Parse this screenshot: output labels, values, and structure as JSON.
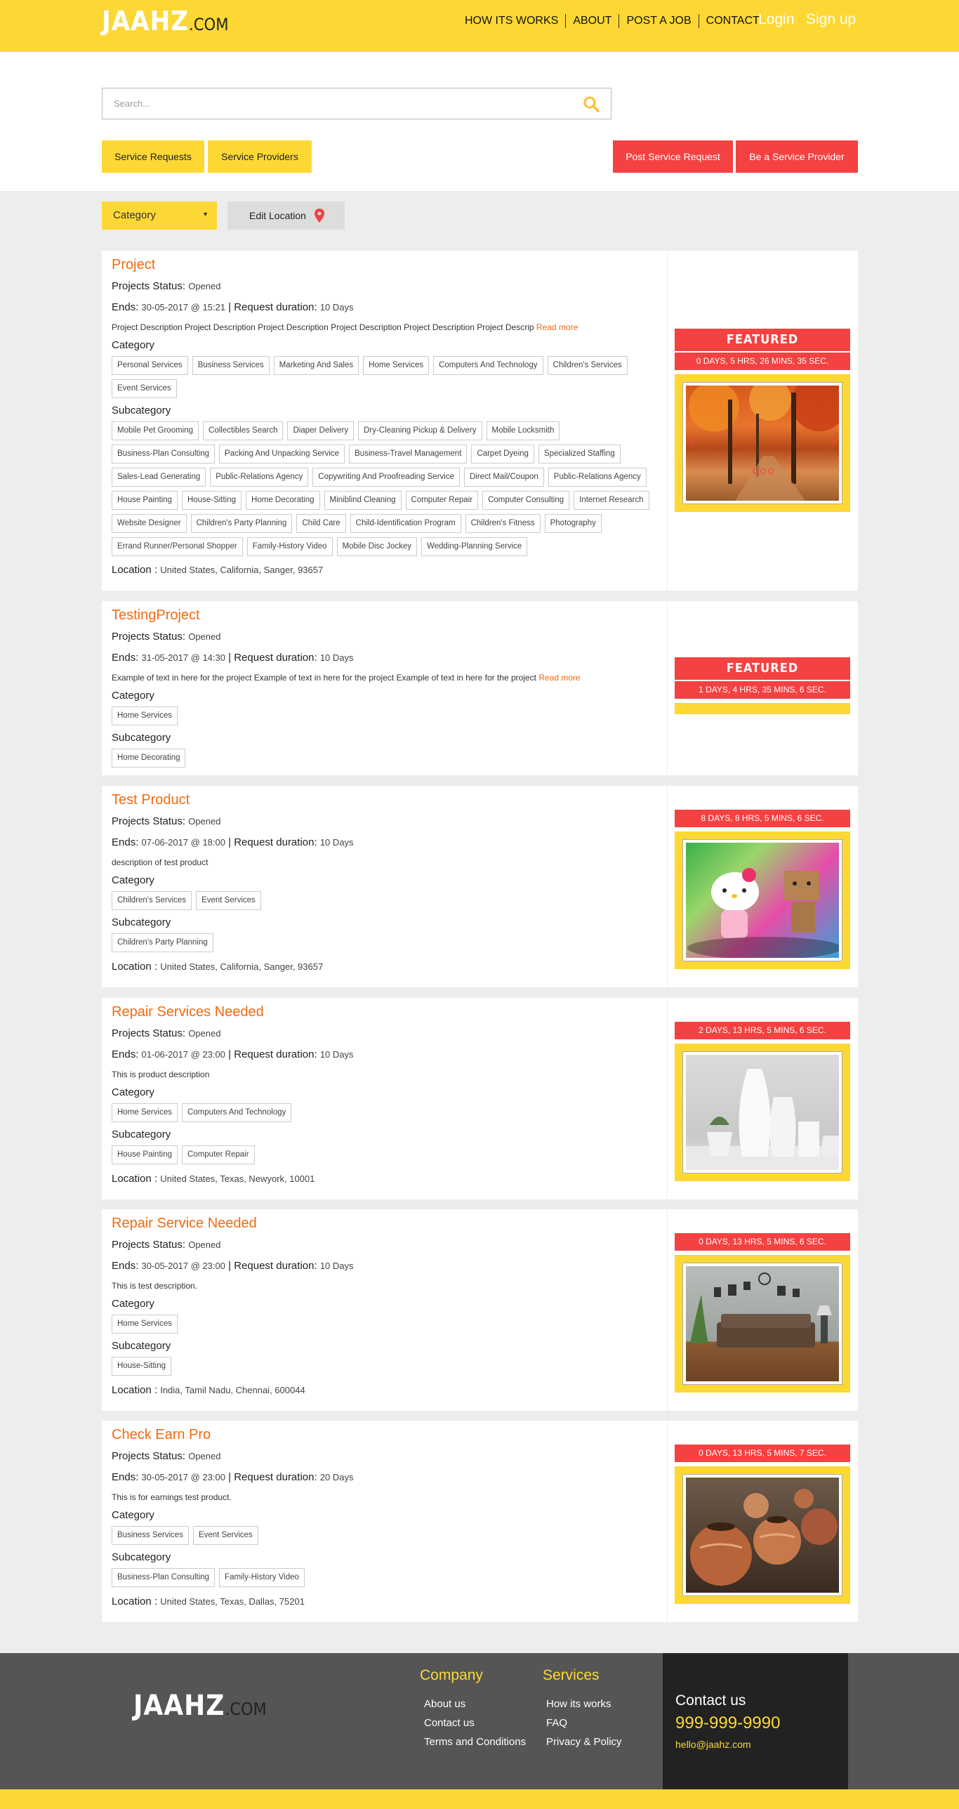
{
  "header": {
    "logo_main": "JAAHZ",
    "logo_suffix": ".COM",
    "nav": [
      "HOW ITS WORKS",
      "ABOUT",
      "POST A JOB",
      "CONTACT"
    ],
    "login": "Login",
    "signup": "Sign up"
  },
  "search": {
    "placeholder": "Search..."
  },
  "buttons": {
    "service_requests": "Service Requests",
    "service_providers": "Service Providers",
    "post_request": "Post Service Request",
    "be_provider": "Be a Service Provider"
  },
  "filters": {
    "category": "Category",
    "edit_location": "Edit Location"
  },
  "labels": {
    "status": "Projects Status:",
    "ends": "Ends:",
    "duration": "Request duration:",
    "category": "Category",
    "subcategory": "Subcategory",
    "location": "Location :",
    "read_more": "Read more",
    "featured": "FEATURED"
  },
  "projects": [
    {
      "title": "Project",
      "status": "Opened",
      "ends": "30-05-2017 @ 15:21",
      "duration": "10 Days",
      "desc": "Project Description Project Description Project Description Project Description Project Description Project Descrip",
      "categories": [
        "Personal Services",
        "Business Services",
        "Marketing And Sales",
        "Home Services",
        "Computers And Technology",
        "Children's Services",
        "Event Services"
      ],
      "subcategories": [
        "Mobile Pet Grooming",
        "Collectibles Search",
        "Diaper Delivery",
        "Dry-Cleaning Pickup & Delivery",
        "Mobile Locksmith",
        "Business-Plan Consulting",
        "Packing And Unpacking Service",
        "Business-Travel Management",
        "Carpet Dyeing",
        "Specialized Staffing",
        "Sales-Lead Generating",
        "Public-Relations Agency",
        "Copywriting And Proofreading Service",
        "Direct Mail/Coupon",
        "Public-Relations Agency",
        "House Painting",
        "House-Sitting",
        "Home Decorating",
        "Miniblind Cleaning",
        "Computer Repair",
        "Computer Consulting",
        "Internet Research",
        "Website Designer",
        "Children's Party Planning",
        "Child Care",
        "Child-Identification Program",
        "Children's Fitness",
        "Photography",
        "Errand Runner/Personal Shopper",
        "Family-History Video",
        "Mobile Disc Jockey",
        "Wedding-Planning Service"
      ],
      "location": "United States, California, Sanger, 93657",
      "featured": true,
      "timer": "0 DAYS, 5 HRS, 26 MINS, 35 SEC.",
      "image": "autumn-forest"
    },
    {
      "title": "TestingProject",
      "status": "Opened",
      "ends": "31-05-2017 @ 14:30",
      "duration": "10 Days",
      "desc": "Example of text in here for the project Example of text in here for the project Example of text in here for the project",
      "categories": [
        "Home Services"
      ],
      "subcategories": [
        "Home Decorating"
      ],
      "location": "",
      "featured": true,
      "timer": "1 DAYS, 4 HRS, 35 MINS, 6 SEC.",
      "image": ""
    },
    {
      "title": "Test Product",
      "status": "Opened",
      "ends": "07-06-2017 @ 18:00",
      "duration": "10 Days",
      "desc": "description of test product",
      "categories": [
        "Children's Services",
        "Event Services"
      ],
      "subcategories": [
        "Children's Party Planning"
      ],
      "location": "United States, California, Sanger, 93657",
      "featured": false,
      "timer": "8 DAYS, 8 HRS, 5 MINS, 6 SEC.",
      "image": "toys"
    },
    {
      "title": "Repair Services Needed",
      "status": "Opened",
      "ends": "01-06-2017 @ 23:00",
      "duration": "10 Days",
      "desc": "This is product description",
      "categories": [
        "Home Services",
        "Computers And Technology"
      ],
      "subcategories": [
        "House Painting",
        "Computer Repair"
      ],
      "location": "United States, Texas, Newyork, 10001",
      "featured": false,
      "timer": "2 DAYS, 13 HRS, 5 MINS, 6 SEC.",
      "image": "vases"
    },
    {
      "title": "Repair Service Needed",
      "status": "Opened",
      "ends": "30-05-2017 @ 23:00",
      "duration": "10 Days",
      "desc": "This is test description.",
      "categories": [
        "Home Services"
      ],
      "subcategories": [
        "House-Sitting"
      ],
      "location": "India, Tamil Nadu, Chennai, 600044",
      "featured": false,
      "timer": "0 DAYS, 13 HRS, 5 MINS, 6 SEC.",
      "image": "living-room"
    },
    {
      "title": "Check Earn Pro",
      "status": "Opened",
      "ends": "30-05-2017 @ 23:00",
      "duration": "20 Days",
      "desc": "This is for earnings test product.",
      "categories": [
        "Business Services",
        "Event Services"
      ],
      "subcategories": [
        "Business-Plan Consulting",
        "Family-History Video"
      ],
      "location": "United States, Texas, Dallas, 75201",
      "featured": false,
      "timer": "0 DAYS, 13 HRS, 5 MINS, 7 SEC.",
      "image": "pottery"
    }
  ],
  "footer": {
    "logo_main": "JAAHZ",
    "logo_suffix": ".COM",
    "company_heading": "Company",
    "company_links": [
      "About us",
      "Contact us",
      "Terms and Conditions"
    ],
    "services_heading": "Services",
    "services_links": [
      "How its works",
      "FAQ",
      "Privacy & Policy"
    ],
    "contact_heading": "Contact us",
    "phone": "999-999-9990",
    "email": "hello@jaahz.com"
  },
  "colors": {
    "brand_yellow": "#fdd835",
    "accent_red": "#f44141",
    "title_orange": "#f26a0e"
  }
}
